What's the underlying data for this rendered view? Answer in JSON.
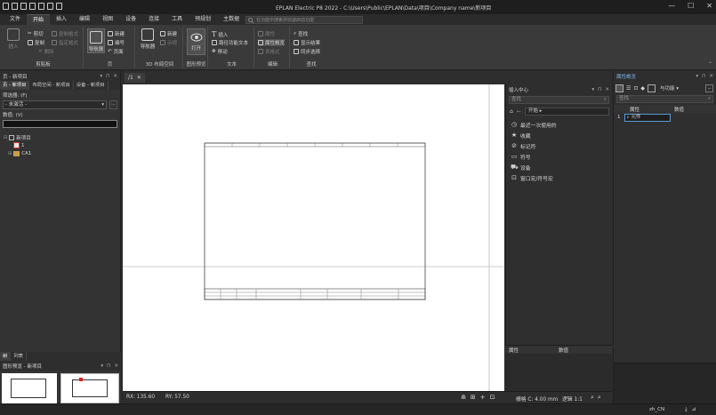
{
  "app": {
    "title": "EPLAN Electric P8 2022 - C:\\Users\\Public\\EPLAN\\Data\\项目\\Company name\\新项目",
    "search_placeholder": "在功能中搜索并快速启动功能",
    "window_controls": [
      "—",
      "☐",
      "✕"
    ]
  },
  "menu": [
    "文件",
    "开始",
    "插入",
    "编辑",
    "视图",
    "设备",
    "连接",
    "工具",
    "预规划",
    "主数据"
  ],
  "ribbon": {
    "clipboard": {
      "label": "剪贴板",
      "paste": "插入",
      "cut": "剪切",
      "copy": "复制",
      "copy_format": "复制格式",
      "paste_format": "指定格式",
      "delete": "删除"
    },
    "page": {
      "label": "页",
      "navigator": "导航器",
      "new": "新建",
      "number": "编号",
      "back": "页面"
    },
    "layout3d": {
      "label": "3D 布局空间",
      "navigator": "导航器",
      "new": "新建",
      "display": "示视"
    },
    "preview": {
      "label": "图形预览",
      "open": "打开"
    },
    "text": {
      "label": "文本",
      "insert": "插入",
      "autofit": "路径功能文本",
      "move": "移动"
    },
    "edit": {
      "label": "编辑",
      "properties": "属性",
      "prop_overview": "属性概览",
      "table": "表格式"
    },
    "find": {
      "label": "查找",
      "find": "查找",
      "show_results": "显示结果",
      "sync": "同步选择"
    }
  },
  "left_panel": {
    "title": "页 - 新项目",
    "tabs": [
      "页 - 新项目",
      "布局空间 - 新项目",
      "设备 - 新项目"
    ],
    "filter_label": "筛选器: (F)",
    "filter_value": "- 未激活 -",
    "value_label": "数值: (V)",
    "tree": [
      "新项目",
      "1",
      "CA1"
    ],
    "bottom_tabs": [
      "树",
      "列表"
    ]
  },
  "preview_panel": {
    "title": "图形预览 - 新项目"
  },
  "doc_tab": "/1",
  "status": {
    "rx": "RX: 135.60",
    "ry": "RY: 57.50",
    "grid": "栅格 C: 4.00 mm",
    "logic": "逻辑 1:1"
  },
  "insert_center": {
    "title": "插入中心",
    "search_placeholder": "查找",
    "breadcrumb": "开始",
    "items": [
      "最近一次使用的",
      "收藏",
      "标记符",
      "符号",
      "设备",
      "窗口宏/符号宏"
    ],
    "prop_col": "属性",
    "value_col": "数值"
  },
  "prop_overview": {
    "title": "属性概览",
    "search_placeholder": "查找",
    "dropdown": "与功能",
    "col_prop": "属性",
    "col_value": "数值",
    "row_index": "1",
    "row_value": "元件"
  },
  "bottom": {
    "locale": "zh_CN"
  }
}
